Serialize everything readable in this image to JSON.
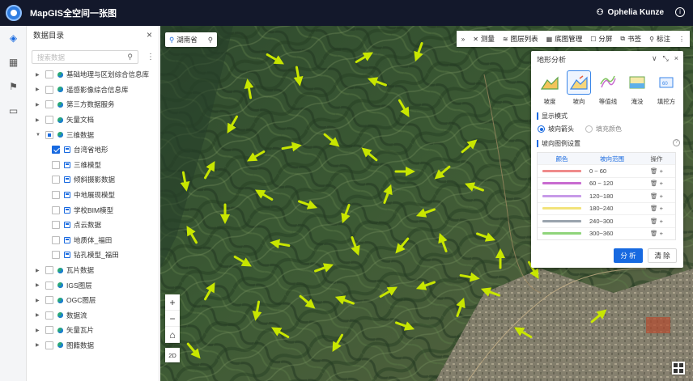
{
  "topbar": {
    "title": "MapGIS全空间一张图",
    "user_name": "Ophelia Kunze",
    "info": "i"
  },
  "rail": {
    "items": [
      {
        "icon": "layers-icon",
        "glyph": "◈",
        "active": true
      },
      {
        "icon": "grid-icon",
        "glyph": "▦",
        "active": false
      },
      {
        "icon": "flag-icon",
        "glyph": "⚑",
        "active": false
      },
      {
        "icon": "monitor-icon",
        "glyph": "▭",
        "active": false
      }
    ]
  },
  "catalog": {
    "title": "数据目录",
    "close": "×",
    "search_placeholder": "搜索数据",
    "more": "⋮",
    "tree": [
      {
        "label": "基础地理与区划综合信息库",
        "level": 0,
        "expanded": false,
        "checked": "none"
      },
      {
        "label": "遥感影像综合信息库",
        "level": 0,
        "expanded": false,
        "checked": "none"
      },
      {
        "label": "第三方数据服务",
        "level": 0,
        "expanded": false,
        "checked": "none"
      },
      {
        "label": "矢量文档",
        "level": 0,
        "expanded": false,
        "checked": "none"
      },
      {
        "label": "三维数据",
        "level": 0,
        "expanded": true,
        "checked": "partial"
      },
      {
        "label": "台湾省地形",
        "level": 1,
        "checked": "checked"
      },
      {
        "label": "三维模型",
        "level": 1,
        "checked": "none"
      },
      {
        "label": "倾斜摄影数据",
        "level": 1,
        "checked": "none"
      },
      {
        "label": "中地展现模型",
        "level": 1,
        "checked": "none"
      },
      {
        "label": "学校BIM模型",
        "level": 1,
        "checked": "none"
      },
      {
        "label": "点云数据",
        "level": 1,
        "checked": "none"
      },
      {
        "label": "地质体_福田",
        "level": 1,
        "checked": "none"
      },
      {
        "label": "钻孔模型_福田",
        "level": 1,
        "checked": "none"
      },
      {
        "label": "瓦片数据",
        "level": 0,
        "expanded": false,
        "checked": "none"
      },
      {
        "label": "IGS图层",
        "level": 0,
        "expanded": false,
        "checked": "none"
      },
      {
        "label": "OGC图层",
        "level": 0,
        "expanded": false,
        "checked": "none"
      },
      {
        "label": "数据流",
        "level": 0,
        "expanded": false,
        "checked": "none"
      },
      {
        "label": "矢量瓦片",
        "level": 0,
        "expanded": false,
        "checked": "none"
      },
      {
        "label": "图籍数据",
        "level": 0,
        "expanded": false,
        "checked": "none"
      }
    ]
  },
  "map": {
    "region": "湖南省",
    "toolbar": [
      {
        "label": "",
        "icon": "expand-icon",
        "glyph": "»"
      },
      {
        "label": "测量",
        "icon": "measure-icon",
        "glyph": "✕"
      },
      {
        "label": "图层列表",
        "icon": "layer-list-icon",
        "glyph": "≋"
      },
      {
        "label": "底图管理",
        "icon": "basemap-icon",
        "glyph": "▦"
      },
      {
        "label": "分屏",
        "icon": "split-screen-icon",
        "glyph": "☐"
      },
      {
        "label": "书签",
        "icon": "bookmark-icon",
        "glyph": "⧉"
      },
      {
        "label": "标注",
        "icon": "marker-icon",
        "glyph": "⚲"
      },
      {
        "label": "",
        "icon": "more-icon",
        "glyph": "⋮"
      }
    ],
    "zoom_in": "+",
    "zoom_out": "−",
    "home": "⌂",
    "view_mode": "2D"
  },
  "panel": {
    "title": "地形分析",
    "controls": [
      "∨",
      "⤡",
      "×"
    ],
    "tools": [
      {
        "label": "坡度",
        "icon": "slope-icon",
        "active": false
      },
      {
        "label": "坡向",
        "icon": "aspect-icon",
        "active": true
      },
      {
        "label": "等值线",
        "icon": "contour-icon",
        "active": false
      },
      {
        "label": "淹没",
        "icon": "flood-icon",
        "active": false
      },
      {
        "label": "填挖方",
        "icon": "cut-fill-icon",
        "active": false
      }
    ],
    "display_mode_title": "显示模式",
    "display_modes": [
      {
        "label": "坡向箭头",
        "selected": true
      },
      {
        "label": "填充颜色",
        "selected": false
      }
    ],
    "legend_title": "坡向图例设置",
    "legend_help": "?",
    "legend_headers": {
      "color": "颜色",
      "range": "坡向范围",
      "action": "操作"
    },
    "legend_rows": [
      {
        "color": "#ef8a8a",
        "range": "0 ~ 60",
        "action": "🗑 +"
      },
      {
        "color": "#c86bd0",
        "range": "60 ~ 120",
        "action": "🗑 +"
      },
      {
        "color": "#c79ae8",
        "range": "120~180",
        "action": "🗑 +"
      },
      {
        "color": "#f2e37a",
        "range": "180~240",
        "action": "🗑 +"
      },
      {
        "color": "#9aa3ad",
        "range": "240~300",
        "action": "🗑 +"
      },
      {
        "color": "#8fd47a",
        "range": "300~360",
        "action": "🗑 +"
      }
    ],
    "analyze_label": "分 析",
    "clear_label": "清 除"
  },
  "colors": {
    "topbar_bg": "#13182b",
    "accent": "#1769e0",
    "arrow": "#c8e600"
  }
}
